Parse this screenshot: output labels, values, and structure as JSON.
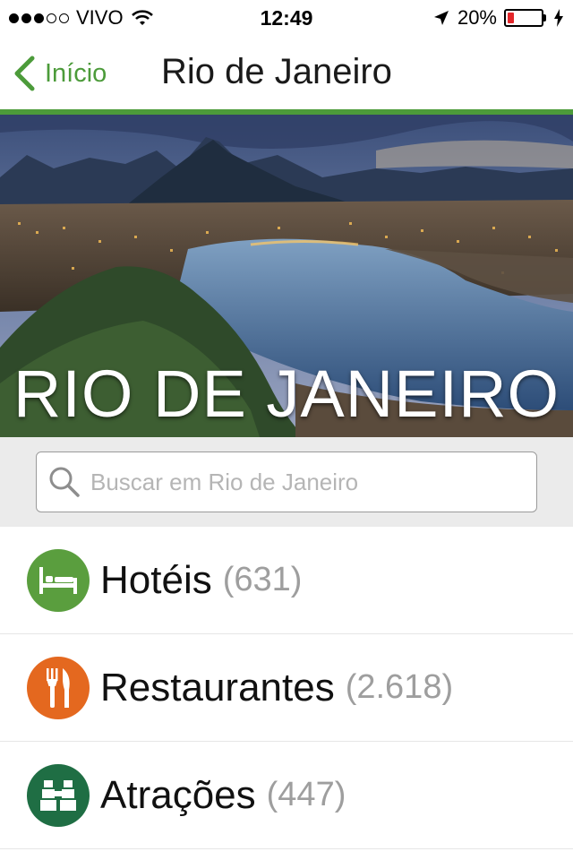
{
  "status_bar": {
    "carrier": "VIVO",
    "time": "12:49",
    "battery_percent": "20%",
    "battery_level": 0.2,
    "icons": [
      "signal-dots",
      "wifi-icon",
      "location-arrow-icon",
      "battery-icon",
      "charging-bolt-icon"
    ]
  },
  "nav": {
    "back_label": "Início",
    "title": "Rio de Janeiro",
    "accent_color": "#4c9b3a"
  },
  "hero": {
    "title": "RIO DE JANEIRO"
  },
  "search": {
    "placeholder": "Buscar em Rio de Janeiro",
    "value": ""
  },
  "categories": [
    {
      "name": "Hotéis",
      "count": "(631)",
      "icon": "bed-icon",
      "color": "#5a9e3e"
    },
    {
      "name": "Restaurantes",
      "count": "(2.618)",
      "icon": "fork-knife-icon",
      "color": "#e4681f"
    },
    {
      "name": "Atrações",
      "count": "(447)",
      "icon": "binoculars-icon",
      "color": "#1f6e44"
    }
  ]
}
